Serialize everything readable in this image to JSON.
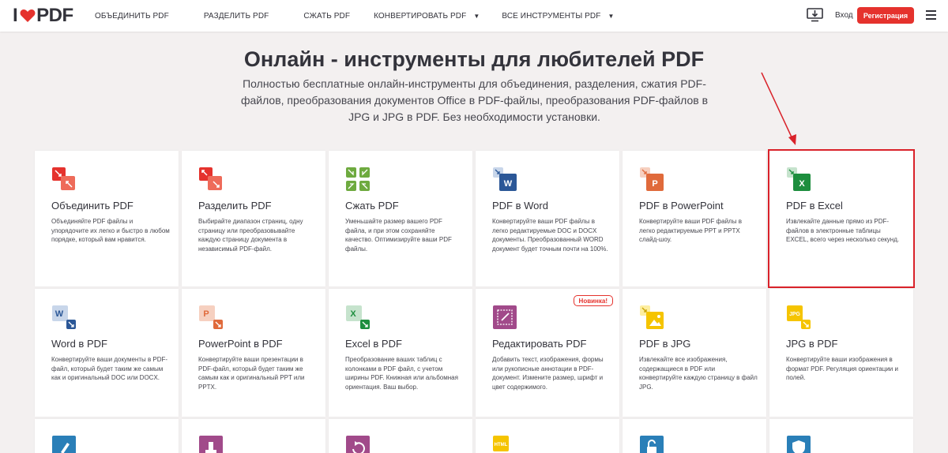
{
  "header": {
    "logo_prefix": "I",
    "logo_suffix": "PDF",
    "nav": [
      {
        "label": "ОБЪЕДИНИТЬ PDF",
        "caret": false
      },
      {
        "label": "РАЗДЕЛИТЬ PDF",
        "caret": false
      },
      {
        "label": "СЖАТЬ PDF",
        "caret": false
      },
      {
        "label": "КОНВЕРТИРОВАТЬ PDF",
        "caret": true
      },
      {
        "label": "ВСЕ ИНСТРУМЕНТЫ PDF",
        "caret": true
      }
    ],
    "login_label": "Вход",
    "signup_label": "Регистрация"
  },
  "hero": {
    "title": "Онлайн - инструменты для любителей PDF",
    "subtitle": "Полностью бесплатные онлайн-инструменты для объединения, разделения, сжатия PDF-файлов, преобразования документов Office в PDF-файлы, преобразования PDF-файлов в JPG и JPG в PDF. Без необходимости установки."
  },
  "colors": {
    "brand_red": "#e5322d",
    "merge": "#e5322d",
    "compress": "#6eaa3f",
    "word": "#2b5797",
    "powerpoint": "#e06a3b",
    "excel": "#1d8e3e",
    "edit": "#a14a8a",
    "jpg": "#f5c400"
  },
  "tools": [
    {
      "title": "Объединить PDF",
      "icon": "merge-icon",
      "desc": "Объединяйте PDF файлы и упорядочите их легко и быстро в любом порядке, который вам нравится."
    },
    {
      "title": "Разделить PDF",
      "icon": "split-icon",
      "desc": "Выбирайте диапазон страниц, одну страницу или преобразовывайте каждую страницу документа в независимый PDF-файл."
    },
    {
      "title": "Сжать PDF",
      "icon": "compress-icon",
      "desc": "Уменьшайте размер вашего PDF файла, и при этом сохраняйте качество. Оптимизируйте ваши PDF файлы."
    },
    {
      "title": "PDF в Word",
      "icon": "pdf-to-word-icon",
      "desc": "Конвертируйте ваши PDF файлы в легко редактируемые DOC и DOCX документы. Преобразованный WORD документ будет точным почти на 100%."
    },
    {
      "title": "PDF в PowerPoint",
      "icon": "pdf-to-powerpoint-icon",
      "desc": "Конвертируйте ваши PDF файлы в легко редактируемые PPT и PPTX слайд-шоу."
    },
    {
      "title": "PDF в Excel",
      "icon": "pdf-to-excel-icon",
      "desc": "Извлекайте данные прямо из PDF-файлов в электронные таблицы EXCEL, всего через несколько секунд."
    },
    {
      "title": "Word в PDF",
      "icon": "word-to-pdf-icon",
      "desc": "Конвертируйте ваши документы в PDF-файл, который будет таким же самым как и оригинальный DOC или DOCX."
    },
    {
      "title": "PowerPoint в PDF",
      "icon": "powerpoint-to-pdf-icon",
      "desc": "Конвертируйте ваши презентации в PDF-файл, который будет таким же самым как и оригинальный PPT или PPTX."
    },
    {
      "title": "Excel в PDF",
      "icon": "excel-to-pdf-icon",
      "desc": "Преобразование ваших таблиц с колонками в PDF файл, с учетом ширины PDF. Книжная или альбомная ориентация. Ваш выбор."
    },
    {
      "title": "Редактировать PDF",
      "icon": "edit-pdf-icon",
      "desc": "Добавить текст, изображения, формы или рукописные аннотации в PDF-документ. Измените размер, шрифт и цвет содержимого.",
      "badge": "Новинка!"
    },
    {
      "title": "PDF в JPG",
      "icon": "pdf-to-jpg-icon",
      "desc": "Извлекайте все изображения, содержащиеся в PDF или конвертируйте каждую страницу в файл JPG."
    },
    {
      "title": "JPG в PDF",
      "icon": "jpg-to-pdf-icon",
      "desc": "Конвертируйте ваши изображения в формат PDF. Регуляция ориентации и полей."
    }
  ],
  "row3_icons": [
    "sign-pdf-icon",
    "watermark-icon",
    "rotate-pdf-icon",
    "html-to-pdf-icon",
    "unlock-pdf-icon",
    "protect-pdf-icon"
  ],
  "icon_glyphs": {
    "word_letter": "W",
    "powerpoint_letter": "P",
    "excel_letter": "X",
    "jpg_label": "JPG",
    "html_label": "HTML"
  }
}
